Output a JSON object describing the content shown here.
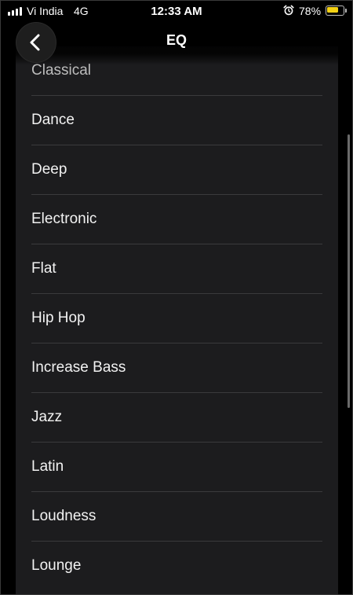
{
  "status_bar": {
    "carrier": "Vi India",
    "network": "4G",
    "time": "12:33 AM",
    "battery_percent": "78%",
    "battery_level": 0.78,
    "battery_color": "#f5d214",
    "alarm_icon": "alarm-clock-icon",
    "signal_icon": "signal-bars-icon"
  },
  "header": {
    "title": "EQ",
    "back_icon": "chevron-left-icon"
  },
  "eq_presets": [
    {
      "label": "Classical"
    },
    {
      "label": "Dance"
    },
    {
      "label": "Deep"
    },
    {
      "label": "Electronic"
    },
    {
      "label": "Flat"
    },
    {
      "label": "Hip Hop"
    },
    {
      "label": "Increase Bass"
    },
    {
      "label": "Jazz"
    },
    {
      "label": "Latin"
    },
    {
      "label": "Loudness"
    },
    {
      "label": "Lounge"
    }
  ],
  "colors": {
    "background": "#000000",
    "panel": "#1c1c1e",
    "divider": "#3a3a3c",
    "text": "#f2f2f2"
  }
}
